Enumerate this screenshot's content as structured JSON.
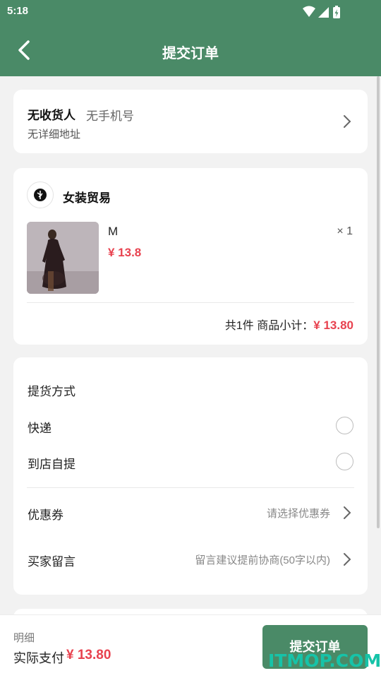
{
  "status_bar": {
    "time": "5:18",
    "icons": [
      "wifi-icon",
      "signal-icon",
      "battery-icon"
    ]
  },
  "header": {
    "title": "提交订单",
    "back_icon": "chevron-left-icon"
  },
  "address": {
    "recipient": "无收货人",
    "phone": "无手机号",
    "detail": "无详细地址"
  },
  "order": {
    "shop_name": "女装贸易",
    "item": {
      "spec": "M",
      "price": "¥ 13.8",
      "quantity": "× 1"
    },
    "subtotal_label": "共1件 商品小计：",
    "subtotal_amount": "¥ 13.80"
  },
  "options": {
    "delivery_title": "提货方式",
    "delivery_methods": [
      "快递",
      "到店自提"
    ],
    "coupon_label": "优惠券",
    "coupon_hint": "请选择优惠券",
    "message_label": "买家留言",
    "message_hint": "留言建议提前协商(50字以内)"
  },
  "footer": {
    "detail_label": "明细",
    "pay_label": "实际支付",
    "pay_amount": "¥ 13.80",
    "submit_label": "提交订单"
  },
  "watermark": "ITMOP.COM",
  "colors": {
    "brand": "#4a8a67",
    "price": "#e8424f",
    "watermark": "#16c3a8"
  }
}
